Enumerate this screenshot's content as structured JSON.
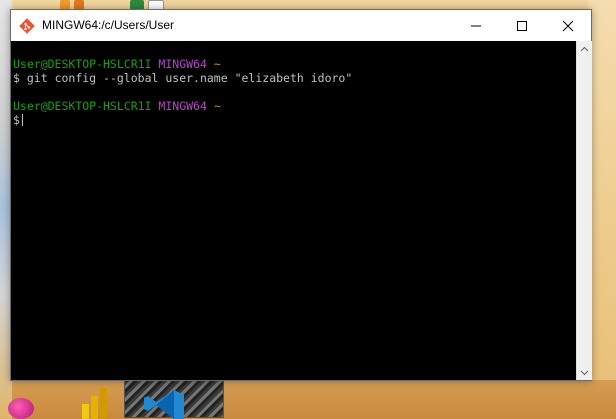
{
  "window": {
    "title": "MINGW64:/c/Users/User"
  },
  "terminal": {
    "lines": [
      {
        "user_host": "User@DESKTOP-HSLCR1I",
        "env": "MINGW64",
        "path": "~"
      },
      {
        "prompt": "$",
        "command": "git config --global user.name \"elizabeth idoro\""
      },
      {
        "user_host": "User@DESKTOP-HSLCR1I",
        "env": "MINGW64",
        "path": "~"
      },
      {
        "prompt": "$",
        "command": ""
      }
    ]
  },
  "colors": {
    "terminal_bg": "#000000",
    "user_host": "#13a10e",
    "env": "#b148c6",
    "path": "#c19c00",
    "text": "#c0c0c0"
  },
  "icons": {
    "app": "git-bash-icon",
    "minimize": "minimize-icon",
    "maximize": "maximize-icon",
    "close": "close-icon",
    "scroll_up": "chevron-up-icon",
    "scroll_down": "chevron-down-icon"
  }
}
